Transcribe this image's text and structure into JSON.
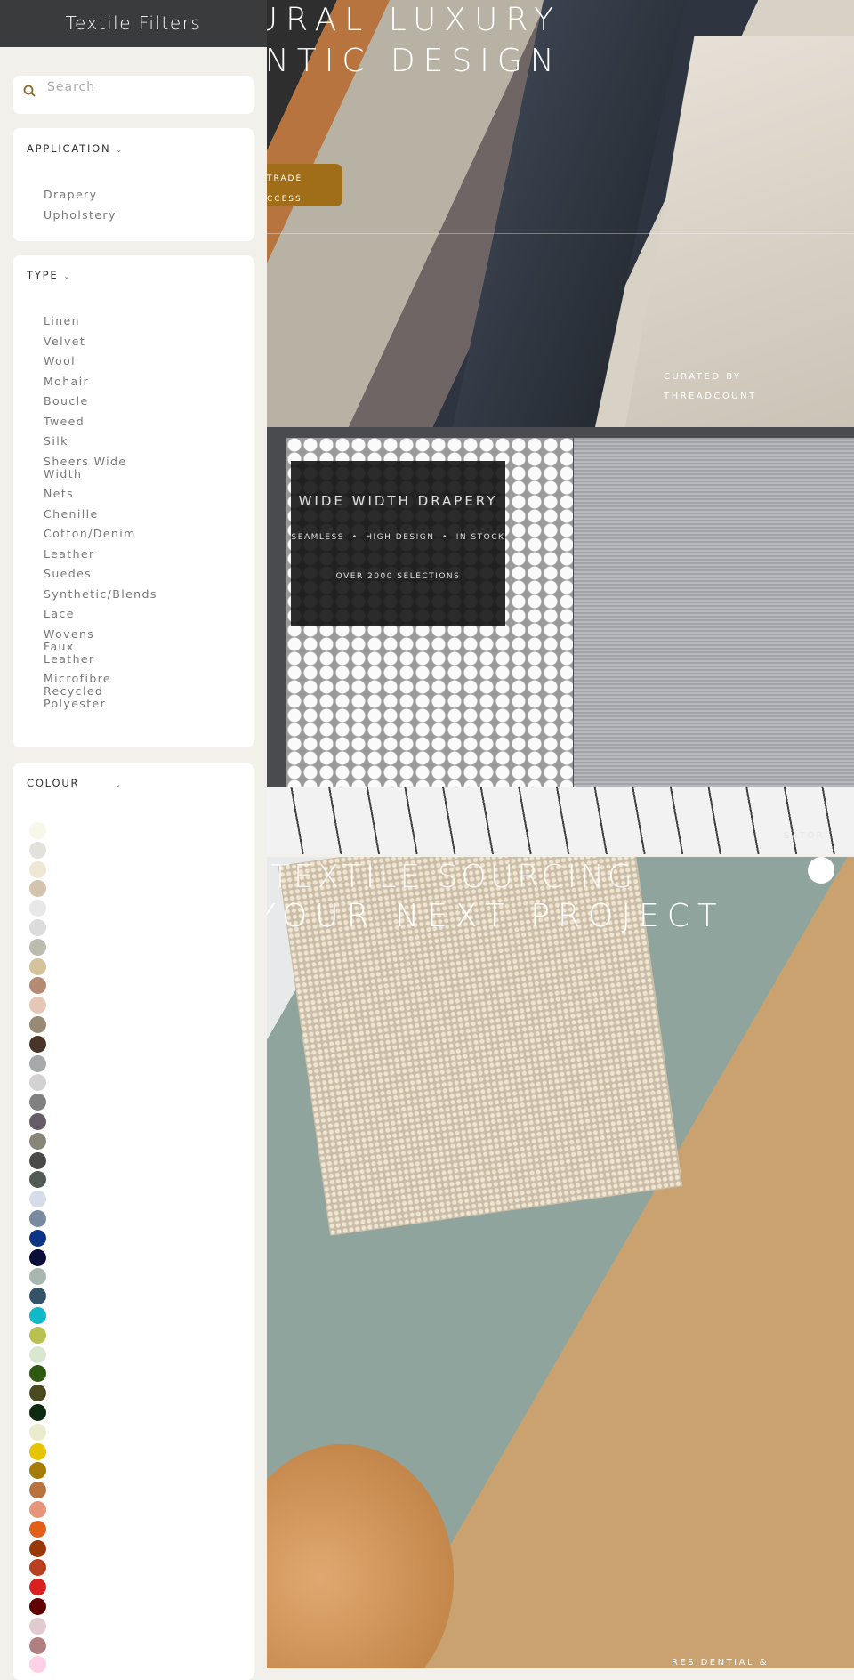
{
  "sidebar": {
    "title": "Textile Filters",
    "search": {
      "placeholder": "Search",
      "value": "",
      "icon": "search-icon"
    },
    "application": {
      "label": "APPLICATION",
      "items": [
        "Drapery",
        "Upholstery"
      ]
    },
    "type": {
      "label": "TYPE",
      "items": [
        "Linen",
        "Velvet",
        "Wool",
        "Mohair",
        "Boucle",
        "Tweed",
        "Silk",
        "Sheers Wide Width",
        "Nets",
        "Chenille",
        "Cotton/Denim",
        "Leather",
        "Suedes",
        "Synthetic/Blends",
        "Lace",
        "Wovens Faux Leather",
        "Microfibre Recycled Polyester"
      ]
    },
    "colour": {
      "label": "COLOUR",
      "swatches": [
        "#f8f8ea",
        "#e3e1dc",
        "#efe8d6",
        "#d2c4ad",
        "#e8e8e8",
        "#dcdcdc",
        "#bcbcae",
        "#d4c29a",
        "#b58a72",
        "#e6c6b4",
        "#998a76",
        "#4a3628",
        "#a6a8aa",
        "#d2d2d2",
        "#808080",
        "#665c68",
        "#888678",
        "#4a4a48",
        "#525a56",
        "#d6dde8",
        "#788aa0",
        "#0e3585",
        "#0a0f3a",
        "#a8b8b0",
        "#345268",
        "#10b8c8",
        "#b8c050",
        "#d8e8d0",
        "#2e5a10",
        "#4a4a20",
        "#0e2a10",
        "#eaeacc",
        "#e6c400",
        "#a67c08",
        "#b87440",
        "#e6947a",
        "#e0601a",
        "#983808",
        "#b84020",
        "#d82020",
        "#600000",
        "#e0ccce",
        "#b08080",
        "#ffd0e8"
      ]
    }
  },
  "hero1": {
    "line1": "NATURAL LUXURY",
    "line2": "AUTHENTIC DESIGN",
    "button_line1": "TRADE",
    "button_line2": "ACCESS",
    "caption_line1": "CURATED BY",
    "caption_line2": "THREADCOUNT"
  },
  "hero2": {
    "heading": "WIDE WIDTH DRAPERY",
    "features": "SEAMLESS  •  HIGH DESIGN  •  IN STOCK",
    "count": "OVER 2000 SELECTIONS",
    "caption": "SATORI"
  },
  "hero3": {
    "line1": "TEXTILE SOURCING",
    "line2": "YOUR NEXT PROJECT",
    "caption": "RESIDENTIAL &"
  },
  "colors": {
    "header": "#3a3b3c",
    "accent": "#a06d18",
    "background": "#f1f0eb"
  }
}
